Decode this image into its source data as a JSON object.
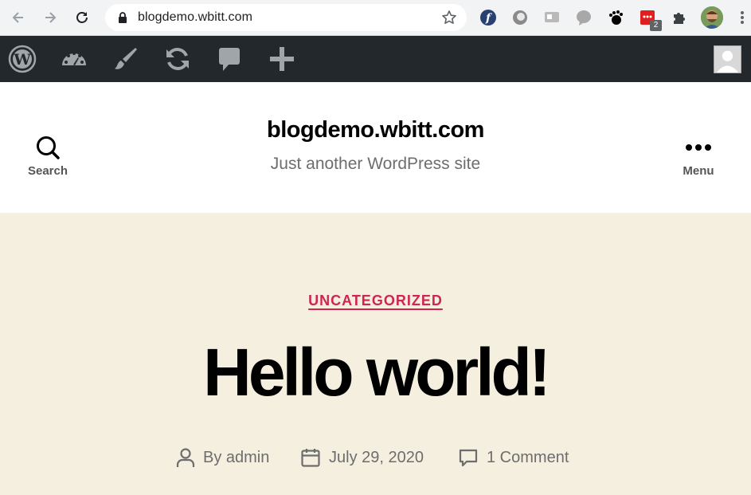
{
  "browser": {
    "url": "blogdemo.wbitt.com",
    "extension_badge": "2",
    "icons": [
      "back-arrow-icon",
      "forward-arrow-icon",
      "reload-icon",
      "lock-icon",
      "bookmark-star-icon",
      "fedora-extension-icon",
      "circle-extension-icon",
      "translate-extension-icon",
      "speech-extension-icon",
      "gnome-extension-icon",
      "red-extension-icon",
      "puzzle-extensions-icon",
      "profile-avatar",
      "kebab-menu-icon"
    ]
  },
  "admin_bar": {
    "icons": [
      "wordpress-logo-icon",
      "dashboard-gauge-icon",
      "customize-brush-icon",
      "updates-refresh-icon",
      "comments-bubble-icon",
      "new-plus-icon",
      "user-avatar"
    ]
  },
  "site_header": {
    "title": "blogdemo.wbitt.com",
    "description": "Just another WordPress site",
    "search_label": "Search",
    "menu_label": "Menu"
  },
  "post": {
    "category": "UNCATEGORIZED",
    "title": "Hello world!",
    "author_label": "By admin",
    "date": "July 29, 2020",
    "comments": "1 Comment"
  },
  "colors": {
    "accent": "#cd2653",
    "admin_bar": "#23282d",
    "background": "#f5efe0",
    "browser_chrome": "#f1f3f4"
  }
}
